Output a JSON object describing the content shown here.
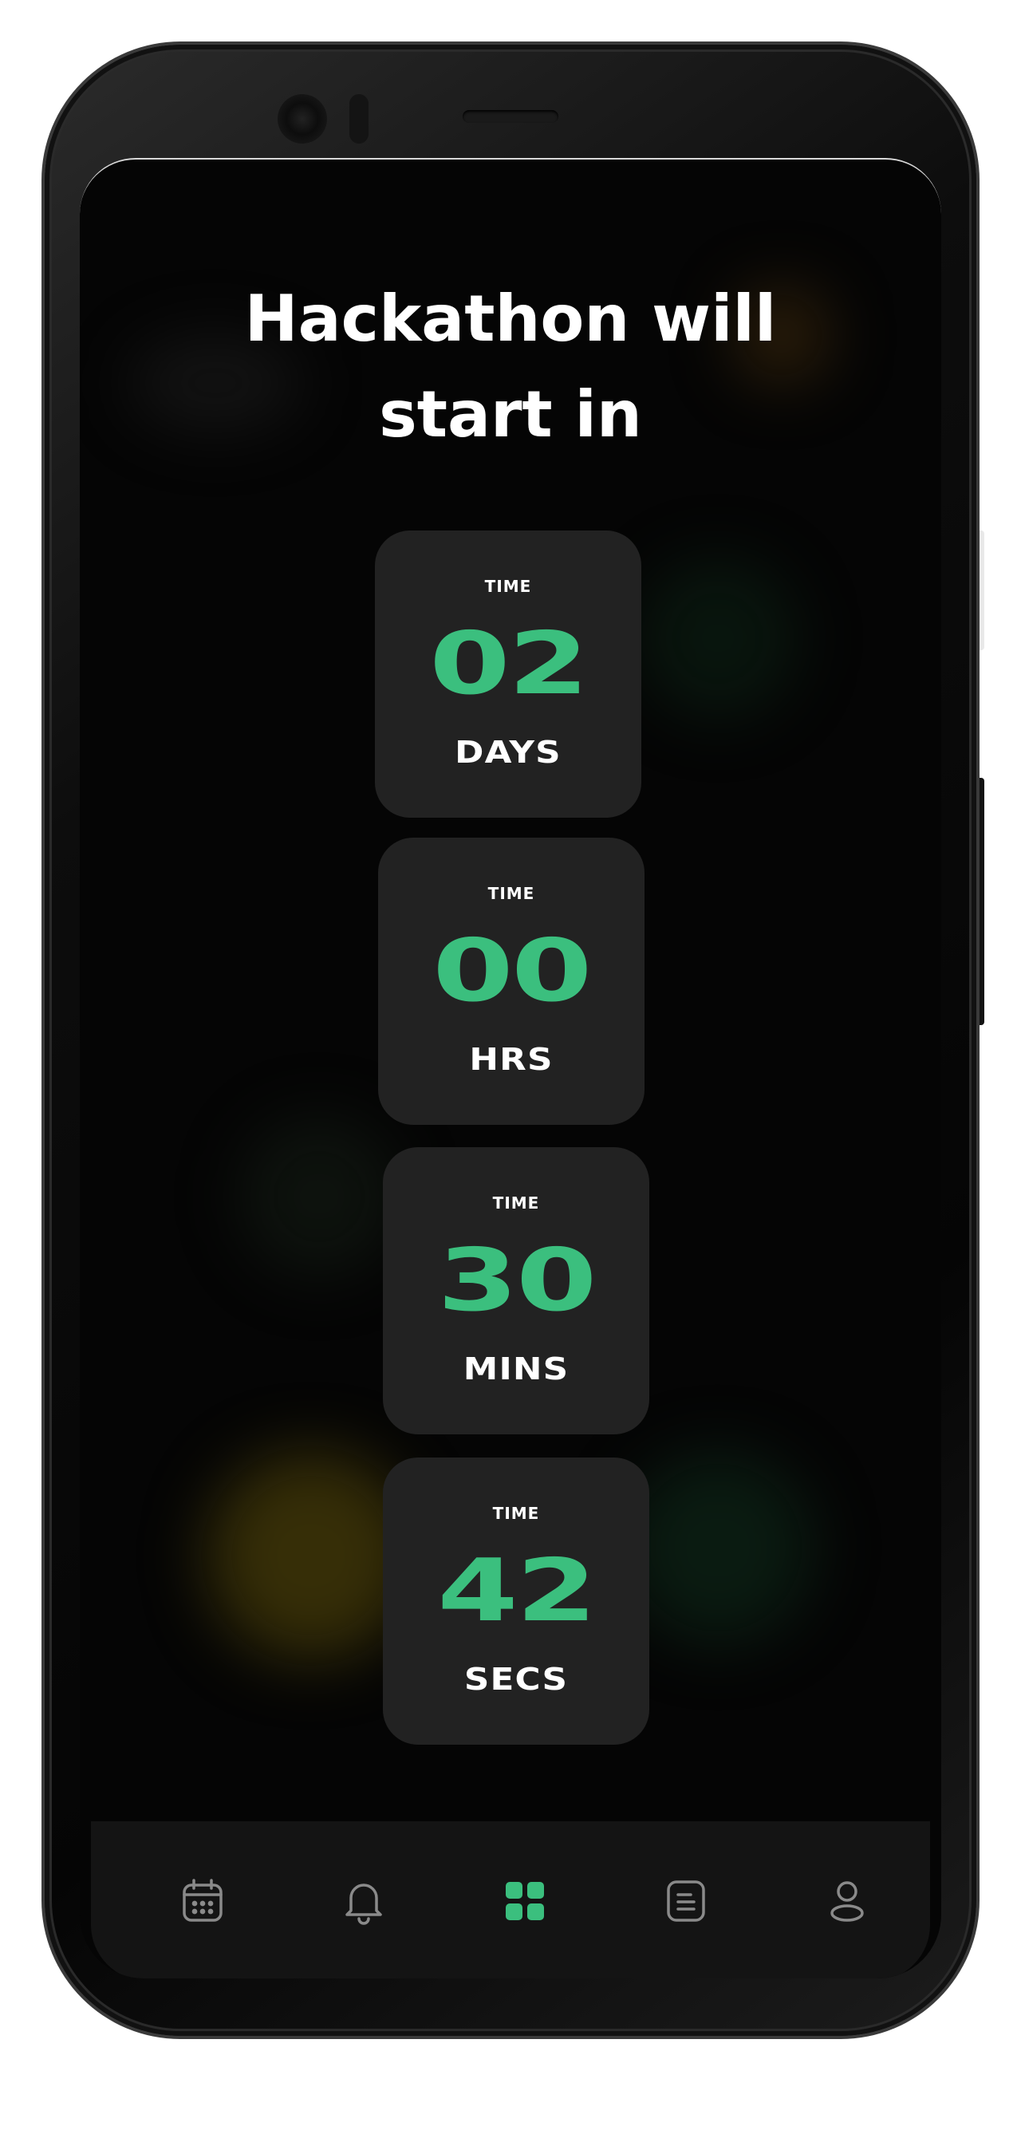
{
  "screen": {
    "title": "Hackathon will start in",
    "title_line1": "Hackathon will",
    "title_line2": "start in"
  },
  "countdown": [
    {
      "label": "TIME",
      "value": "02",
      "unit": "DAYS"
    },
    {
      "label": "TIME",
      "value": "00",
      "unit": "HRS"
    },
    {
      "label": "TIME",
      "value": "30",
      "unit": "MINS"
    },
    {
      "label": "TIME",
      "value": "42",
      "unit": "SECS"
    }
  ],
  "nav": {
    "items": [
      {
        "icon": "calendar-icon",
        "active": false
      },
      {
        "icon": "bell-icon",
        "active": false
      },
      {
        "icon": "dashboard-grid-icon",
        "active": true
      },
      {
        "icon": "document-icon",
        "active": false
      },
      {
        "icon": "profile-icon",
        "active": false
      }
    ]
  },
  "colors": {
    "accent": "#3bbf7e",
    "background": "#050505",
    "card": "#222222",
    "nav_inactive": "#8a8a8a",
    "text": "#ffffff"
  }
}
